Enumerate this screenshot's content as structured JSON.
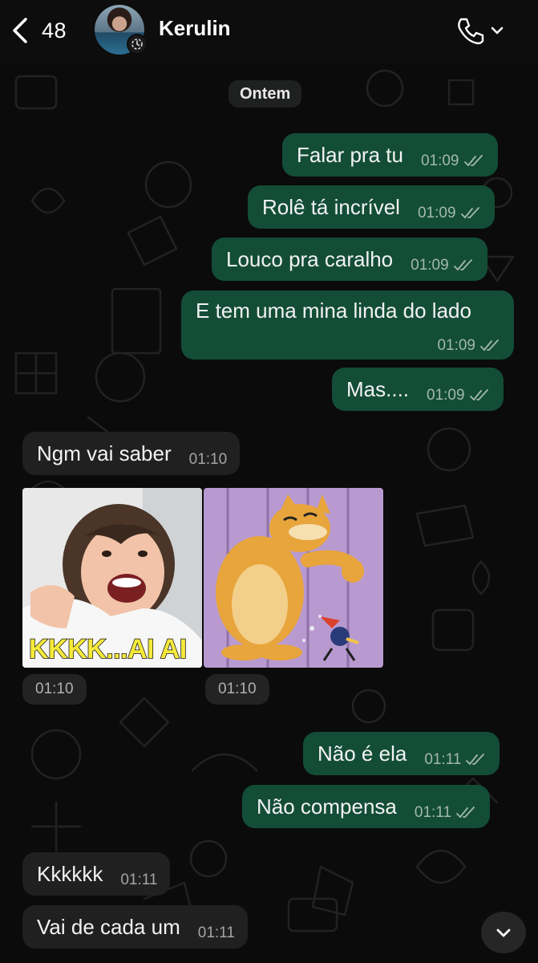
{
  "header": {
    "back_count": "48",
    "contact_name": "Kerulin"
  },
  "date_separator": "Ontem",
  "messages": [
    {
      "direction": "out",
      "text": "Falar pra tu",
      "time": "01:09",
      "status": "read"
    },
    {
      "direction": "out",
      "text": "Rolê tá incrível",
      "time": "01:09",
      "status": "read"
    },
    {
      "direction": "out",
      "text": "Louco pra caralho",
      "time": "01:09",
      "status": "read"
    },
    {
      "direction": "out",
      "text": "E tem uma mina linda do lado",
      "time": "01:09",
      "status": "read"
    },
    {
      "direction": "out",
      "text": "Mas....",
      "time": "01:09",
      "status": "read"
    },
    {
      "direction": "in",
      "text": "Ngm vai saber",
      "time": "01:10"
    },
    {
      "direction": "out",
      "text": "Não é ela",
      "time": "01:11",
      "status": "read"
    },
    {
      "direction": "out",
      "text": "Não compensa",
      "time": "01:11",
      "status": "read"
    },
    {
      "direction": "in",
      "text": "Kkkkkk",
      "time": "01:11"
    },
    {
      "direction": "in",
      "text": "Vai de cada um",
      "time": "01:11"
    }
  ],
  "stickers": [
    {
      "caption": "KKKK...AI AI",
      "time": "01:10"
    },
    {
      "caption": "",
      "time": "01:10"
    }
  ],
  "colors": {
    "background": "#0b0b0b",
    "outgoing_bubble": "#134d37",
    "incoming_bubble": "#202020",
    "read_ticks": "#a3b8ad"
  },
  "icons": [
    "chevron-left-icon",
    "status-timer-icon",
    "phone-icon",
    "chevron-down-icon",
    "double-check-icon",
    "scroll-down-icon"
  ]
}
